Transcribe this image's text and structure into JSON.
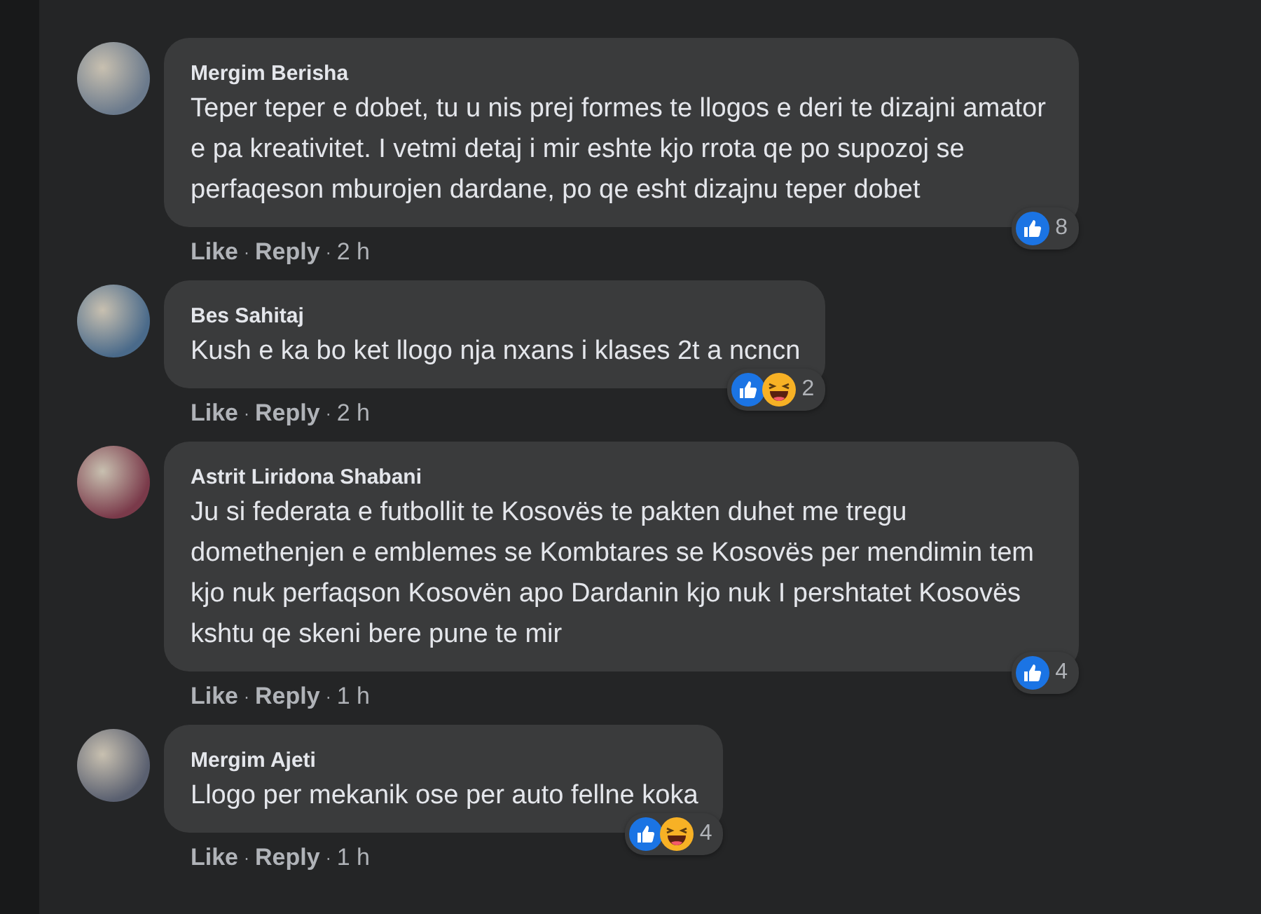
{
  "comments": [
    {
      "author": "Mergim Berisha",
      "text": "Teper teper e dobet, tu u nis prej formes te llogos e deri te dizajni amator e pa kreativitet. I vetmi detaj i mir eshte kjo rrota qe po supozoj se perfaqeson mburojen dardane, po qe esht dizajnu teper dobet",
      "reactions": {
        "icons": [
          {
            "kind": "like"
          }
        ],
        "count": "8"
      },
      "actions": [
        "Like",
        "Reply"
      ],
      "separator": "·",
      "time": "2 h"
    },
    {
      "author": "Bes Sahitaj",
      "text": "Kush e ka bo ket llogo nja nxans i klases 2t a ncncn",
      "reactions": {
        "icons": [
          {
            "kind": "like"
          },
          {
            "kind": "haha"
          }
        ],
        "count": "2"
      },
      "actions": [
        "Like",
        "Reply"
      ],
      "separator": "·",
      "time": "2 h"
    },
    {
      "author": "Astrit Liridona Shabani",
      "text": "Ju si federata e futbollit te Kosovës te pakten duhet me tregu domethenjen e emblemes se Kombtares se Kosovës per mendimin tem kjo nuk perfaqson Kosovën apo Dardanin kjo nuk I pershtatet Kosovës kshtu qe skeni bere pune te mir",
      "reactions": {
        "icons": [
          {
            "kind": "like"
          }
        ],
        "count": "4"
      },
      "actions": [
        "Like",
        "Reply"
      ],
      "separator": "·",
      "time": "1 h"
    },
    {
      "author": "Mergim Ajeti",
      "text": "Llogo per mekanik ose per auto fellne koka",
      "reactions": {
        "icons": [
          {
            "kind": "like"
          },
          {
            "kind": "haha"
          }
        ],
        "count": "4"
      },
      "actions": [
        "Like",
        "Reply"
      ],
      "separator": "·",
      "time": "1 h"
    }
  ]
}
